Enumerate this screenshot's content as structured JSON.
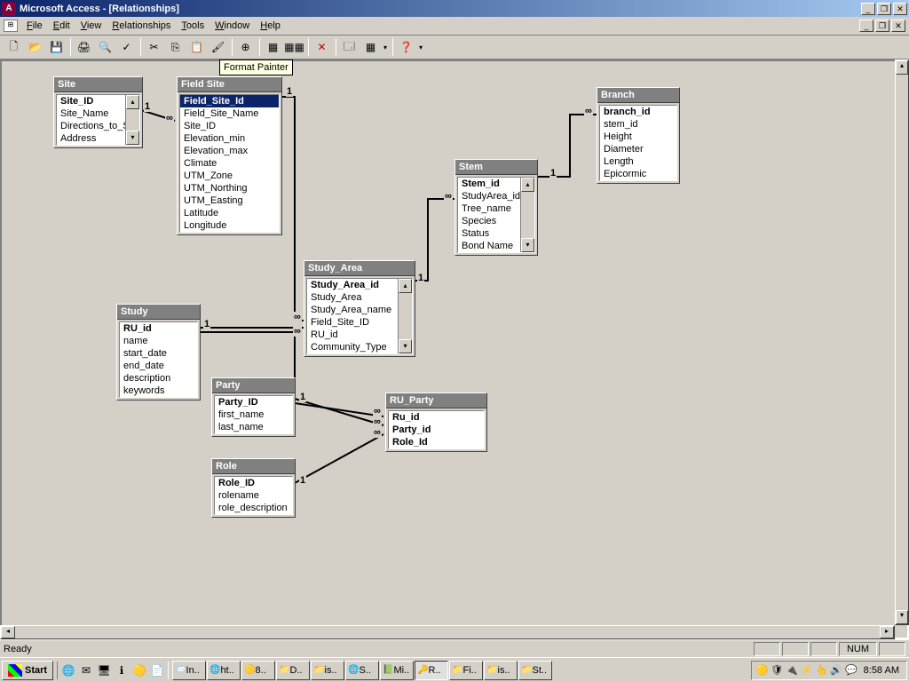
{
  "title": "Microsoft Access - [Relationships]",
  "menus": [
    "File",
    "Edit",
    "View",
    "Relationships",
    "Tools",
    "Window",
    "Help"
  ],
  "tooltip": "Format Painter",
  "tables": {
    "site": {
      "title": "Site",
      "fields": [
        "Site_ID",
        "Site_Name",
        "Directions_to_Si",
        "Address"
      ]
    },
    "fieldsite": {
      "title": "Field Site",
      "fields": [
        "Field_Site_Id",
        "Field_Site_Name",
        "Site_ID",
        "Elevation_min",
        "Elevation_max",
        "Climate",
        "UTM_Zone",
        "UTM_Northing",
        "UTM_Easting",
        "Latitude",
        "Longitude"
      ]
    },
    "studyarea": {
      "title": "Study_Area",
      "fields": [
        "Study_Area_id",
        "Study_Area",
        "Study_Area_name",
        "Field_Site_ID",
        "RU_id",
        "Community_Type"
      ]
    },
    "stem": {
      "title": "Stem",
      "fields": [
        "Stem_id",
        "StudyArea_id",
        "Tree_name",
        "Species",
        "Status",
        "Bond Name"
      ]
    },
    "branch": {
      "title": "Branch",
      "fields": [
        "branch_id",
        "stem_id",
        "Height",
        "Diameter",
        "Length",
        "Epicormic"
      ]
    },
    "study": {
      "title": "Study",
      "fields": [
        "RU_id",
        "name",
        "start_date",
        "end_date",
        "description",
        "keywords"
      ]
    },
    "party": {
      "title": "Party",
      "fields": [
        "Party_ID",
        "first_name",
        "last_name"
      ]
    },
    "role": {
      "title": "Role",
      "fields": [
        "Role_ID",
        "rolename",
        "role_description"
      ]
    },
    "ruparty": {
      "title": "RU_Party",
      "fields": [
        "Ru_id",
        "Party_id",
        "Role_Id"
      ]
    }
  },
  "status": {
    "ready": "Ready",
    "num": "NUM"
  },
  "taskbar": {
    "start": "Start",
    "tasks": [
      "In..",
      "ht..",
      "8..",
      "D..",
      "is..",
      "S..",
      "Mi..",
      "R..",
      "Fi..",
      "is..",
      "St.."
    ],
    "clock": "8:58 AM"
  }
}
